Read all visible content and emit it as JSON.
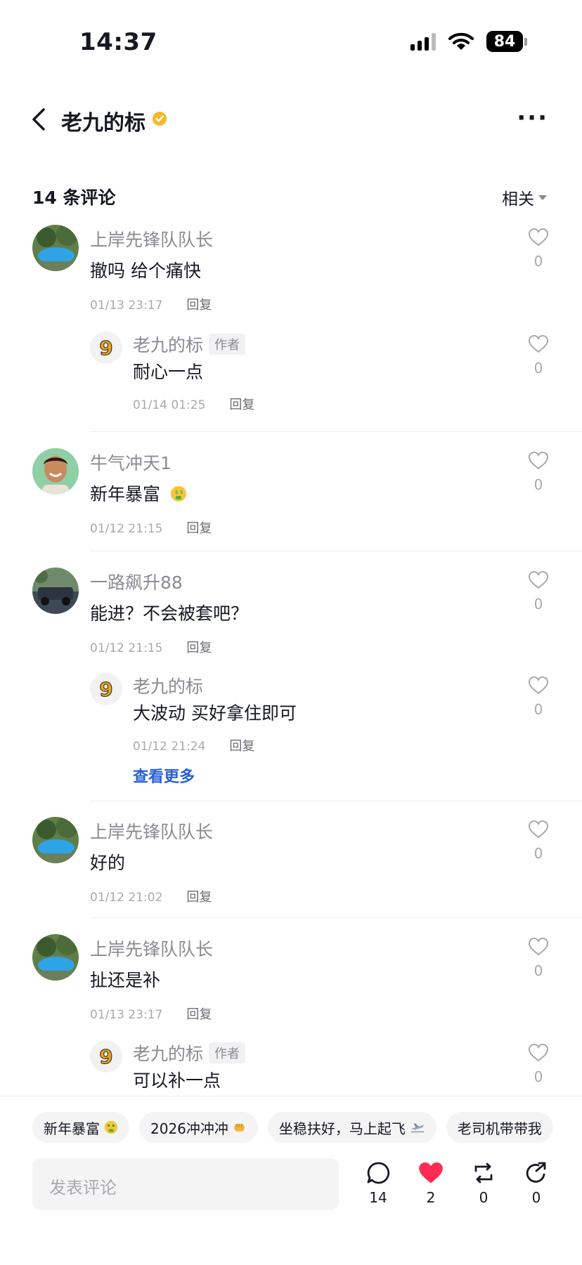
{
  "status_bar": {
    "time": "14:37",
    "battery": "84"
  },
  "header": {
    "title": "老九的标"
  },
  "comments_header": {
    "count_label": "14 条评论",
    "sort_label": "相关"
  },
  "comments": [
    {
      "name": "上岸先锋队队长",
      "text": "撤吗 给个痛快",
      "time": "01/13 23:17",
      "reply": "回复",
      "likes": "0"
    },
    {
      "name": "老九的标",
      "tag": "作者",
      "text": "耐心一点",
      "time": "01/14 01:25",
      "reply": "回复",
      "likes": "0"
    },
    {
      "name": "牛气冲天1",
      "text": "新年暴富",
      "time": "01/12 21:15",
      "reply": "回复",
      "likes": "0"
    },
    {
      "name": "一路飙升88",
      "text": "能进？不会被套吧？",
      "time": "01/12 21:15",
      "reply": "回复",
      "likes": "0"
    },
    {
      "name": "老九的标",
      "text": "大波动 买好拿住即可",
      "time": "01/12 21:24",
      "reply": "回复",
      "likes": "0",
      "see_more": "查看更多"
    },
    {
      "name": "上岸先锋队队长",
      "text": "好的",
      "time": "01/12 21:02",
      "reply": "回复",
      "likes": "0"
    },
    {
      "name": "上岸先锋队队长",
      "text": "扯还是补",
      "time": "01/13 23:17",
      "reply": "回复",
      "likes": "0"
    },
    {
      "name": "老九的标",
      "tag": "作者",
      "text": "可以补一点",
      "likes": "0"
    }
  ],
  "quick_replies": [
    "新年暴富",
    "2026冲冲冲",
    "坐稳扶好，马上起飞",
    "老司机带带我"
  ],
  "input": {
    "placeholder": "发表评论"
  },
  "actions": {
    "comments": "14",
    "likes": "2",
    "reposts": "0",
    "shares": "0"
  },
  "colors": {
    "link": "#2a5fd6",
    "like_red": "#fe2c55",
    "verified": "#f5b82e"
  }
}
